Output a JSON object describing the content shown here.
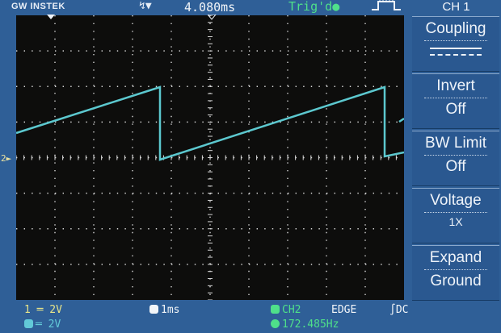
{
  "header": {
    "brand": "GW INSTEK",
    "time_readout": "4.080ms",
    "trigger_status": "Trig'd"
  },
  "menu": {
    "title": "CH 1",
    "items": [
      {
        "label": "Coupling",
        "value": ""
      },
      {
        "label": "Invert",
        "value": "Off"
      },
      {
        "label": "BW Limit",
        "value": "Off"
      },
      {
        "label": "Voltage",
        "value": "1X"
      },
      {
        "label": "Expand",
        "value": "Ground"
      }
    ]
  },
  "status": {
    "ch1_scale": "1 ═ 2V",
    "ch2_scale": "═ 2V",
    "timebase": "1ms",
    "trigger_source": "CH2",
    "trigger_type": "EDGE",
    "trigger_coupling": "DC",
    "frequency": "172.485Hz"
  },
  "colors": {
    "background": "#2f5f97",
    "screen": "#0d0d0c",
    "trace": "#5cc8cf",
    "trigger_green": "#4fe08a",
    "ch1_yellow": "#e7e48a"
  },
  "icons": {
    "run_mode": "double-arrow-icon",
    "trigger_position": "down-arrow-icon",
    "trigger_edge": "rising-pulse-icon"
  }
}
